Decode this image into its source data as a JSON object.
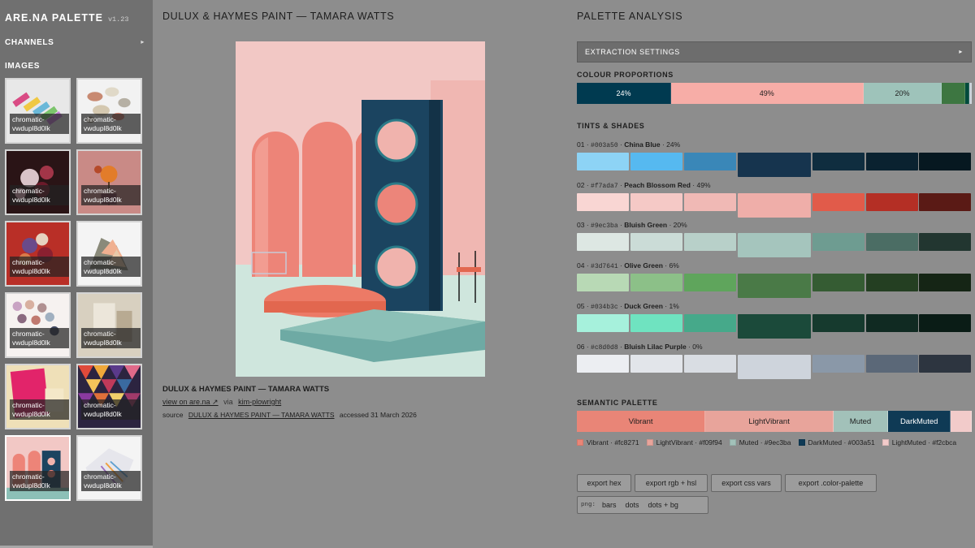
{
  "app": {
    "title": "ARE.NA PALETTE",
    "version": "v1.23"
  },
  "sidebar": {
    "channels_label": "CHANNELS",
    "channels_toggle": "▸",
    "images_label": "IMAGES",
    "thumb_caption": "chromatic-vwdupl8d0lk",
    "thumbnails": [
      {
        "caption": "chromatic-vwdupl8d0lk",
        "art": "chalk-sticks"
      },
      {
        "caption": "chromatic-vwdupl8d0lk",
        "art": "pebbles"
      },
      {
        "caption": "chromatic-vwdupl8d0lk",
        "art": "dark-flowers"
      },
      {
        "caption": "chromatic-vwdupl8d0lk",
        "art": "orange-flower-pink"
      },
      {
        "caption": "chromatic-vwdupl8d0lk",
        "art": "red-bouquet"
      },
      {
        "caption": "chromatic-vwdupl8d0lk",
        "art": "minerals"
      },
      {
        "caption": "chromatic-vwdupl8d0lk",
        "art": "paint-swatches"
      },
      {
        "caption": "chromatic-vwdupl8d0lk",
        "art": "beige-architecture"
      },
      {
        "caption": "chromatic-vwdupl8d0lk",
        "art": "pink-paper"
      },
      {
        "caption": "chromatic-vwdupl8d0lk",
        "art": "geometric-pattern"
      },
      {
        "caption": "chromatic-vwdupl8d0lk",
        "art": "arches-selected"
      },
      {
        "caption": "chromatic-vwdupl8d0lk",
        "art": "white-sculpture"
      }
    ],
    "selected_index": 10
  },
  "center": {
    "title": "DULUX & HAYMES PAINT — TAMARA WATTS",
    "image_caption": "DULUX & HAYMES PAINT — TAMARA WATTS",
    "view_link": "view on are.na ↗",
    "via_label": "via",
    "user_link": "kim-plowright",
    "source_label": "source",
    "source_link": "DULUX & HAYMES PAINT — TAMARA WATTS",
    "accessed": "accessed 31 March 2026"
  },
  "analysis": {
    "title": "PALETTE ANALYSIS",
    "extraction_label": "EXTRACTION SETTINGS",
    "extraction_arrow": "▸",
    "proportions_label": "COLOUR PROPORTIONS",
    "proportions": [
      {
        "color": "#003a50",
        "percent": 24,
        "label": "24%",
        "text_color": "#ffffff"
      },
      {
        "color": "#f7ada7",
        "percent": 49,
        "label": "49%",
        "text_color": "#1e1e1e"
      },
      {
        "color": "#9ec3ba",
        "percent": 20,
        "label": "20%",
        "text_color": "#1e1e1e"
      },
      {
        "color": "#3d7641",
        "percent": 6,
        "label": "",
        "text_color": "#ffffff"
      },
      {
        "color": "#034b3c",
        "percent": 1,
        "label": "",
        "text_color": "#ffffff"
      },
      {
        "color": "#c8d0d8",
        "percent": 0.6,
        "label": "",
        "text_color": "#1e1e1e"
      }
    ],
    "tints_label": "TINTS & SHADES",
    "tints": [
      {
        "index": "01",
        "hex": "#003a50",
        "name": "China Blue",
        "percent": "24%",
        "swatches": [
          "#8dd3f5",
          "#56b9f0",
          "#3a87b8",
          "#16344e",
          "#0f2d3f",
          "#0a2230",
          "#061820"
        ]
      },
      {
        "index": "02",
        "hex": "#f7ada7",
        "name": "Peach Blossom Red",
        "percent": "49%",
        "swatches": [
          "#f9d6d3",
          "#f5c9c6",
          "#f0b9b5",
          "#efaea9",
          "#e15b4a",
          "#b42f25",
          "#5a1a15"
        ]
      },
      {
        "index": "03",
        "hex": "#9ec3ba",
        "name": "Bluish Green",
        "percent": "20%",
        "swatches": [
          "#dde7e3",
          "#cbdcd7",
          "#b8d0c9",
          "#a5c5bd",
          "#6e9c91",
          "#4b6d64",
          "#223630"
        ]
      },
      {
        "index": "04",
        "hex": "#3d7641",
        "name": "Olive Green",
        "percent": "6%",
        "swatches": [
          "#b8d9b5",
          "#8cc088",
          "#5fa55c",
          "#4a7a47",
          "#355c33",
          "#243f22",
          "#152515"
        ]
      },
      {
        "index": "05",
        "hex": "#034b3c",
        "name": "Duck Green",
        "percent": "1%",
        "swatches": [
          "#a6f1dc",
          "#6fe3c0",
          "#46a98a",
          "#1b4a3a",
          "#163a2e",
          "#102a22",
          "#0a1c16"
        ]
      },
      {
        "index": "06",
        "hex": "#c8d0d8",
        "name": "Bluish Lilac Purple",
        "percent": "0%",
        "swatches": [
          "#eceef2",
          "#e2e5ea",
          "#d9dde3",
          "#ced4dc",
          "#8a98a8",
          "#5b6878",
          "#2d3540"
        ]
      }
    ],
    "semantic_label": "SEMANTIC PALETTE",
    "semantic": [
      {
        "name": "Vibrant",
        "hex": "#fc8271",
        "swatch": "#e98577",
        "flex": 1.6,
        "text_color": "#1e1e1e",
        "legend": "Vibrant · #fc8271"
      },
      {
        "name": "LightVibrant",
        "hex": "#f09f94",
        "swatch": "#e8a49b",
        "flex": 1.6,
        "text_color": "#1e1e1e",
        "legend": "LightVibrant · #f09f94"
      },
      {
        "name": "Muted",
        "hex": "#9ec3ba",
        "swatch": "#a2c1b9",
        "flex": 0.67,
        "text_color": "#1e1e1e",
        "legend": "Muted · #9ec3ba"
      },
      {
        "name": "DarkMuted",
        "hex": "#003a51",
        "swatch": "#0f3a55",
        "flex": 0.78,
        "text_color": "#ffffff",
        "legend": "DarkMuted · #003a51"
      },
      {
        "name": "",
        "hex": "#f2cbca",
        "swatch": "#f2cbca",
        "flex": 0.25,
        "text_color": "#1e1e1e",
        "legend": "LightMuted · #f2cbca"
      }
    ],
    "buttons": {
      "hex": "export hex",
      "rgb": "export rgb + hsl",
      "css": "export css vars",
      "palette": "export .color-palette"
    },
    "png": {
      "label": "png:",
      "bars": "bars",
      "dots": "dots",
      "dots_bg": "dots + bg"
    }
  }
}
